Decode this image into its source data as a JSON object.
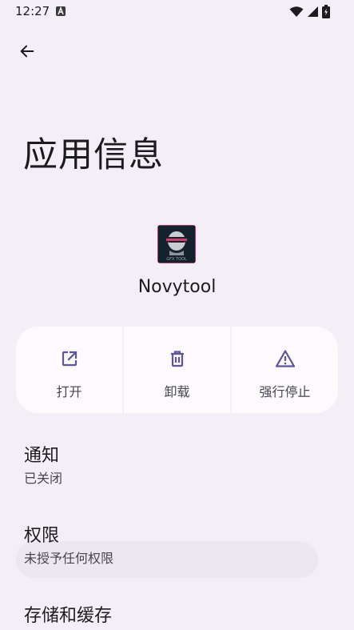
{
  "status_bar": {
    "time": "12:27"
  },
  "header": {
    "back_icon": "arrow-left-icon",
    "title": "应用信息"
  },
  "app": {
    "name": "Novytool",
    "icon_caption": "GFX TOOL"
  },
  "actions": [
    {
      "label": "打开",
      "icon": "open-external-icon"
    },
    {
      "label": "卸载",
      "icon": "trash-icon"
    },
    {
      "label": "强行停止",
      "icon": "warning-icon"
    }
  ],
  "preferences": [
    {
      "title": "通知",
      "summary": "已关闭"
    },
    {
      "title": "权限",
      "summary": "未授予任何权限"
    },
    {
      "title": "存储和缓存",
      "summary": ""
    }
  ],
  "colors": {
    "background": "#f4eff6",
    "card": "#fdf9fd",
    "accent": "#5c5596"
  }
}
